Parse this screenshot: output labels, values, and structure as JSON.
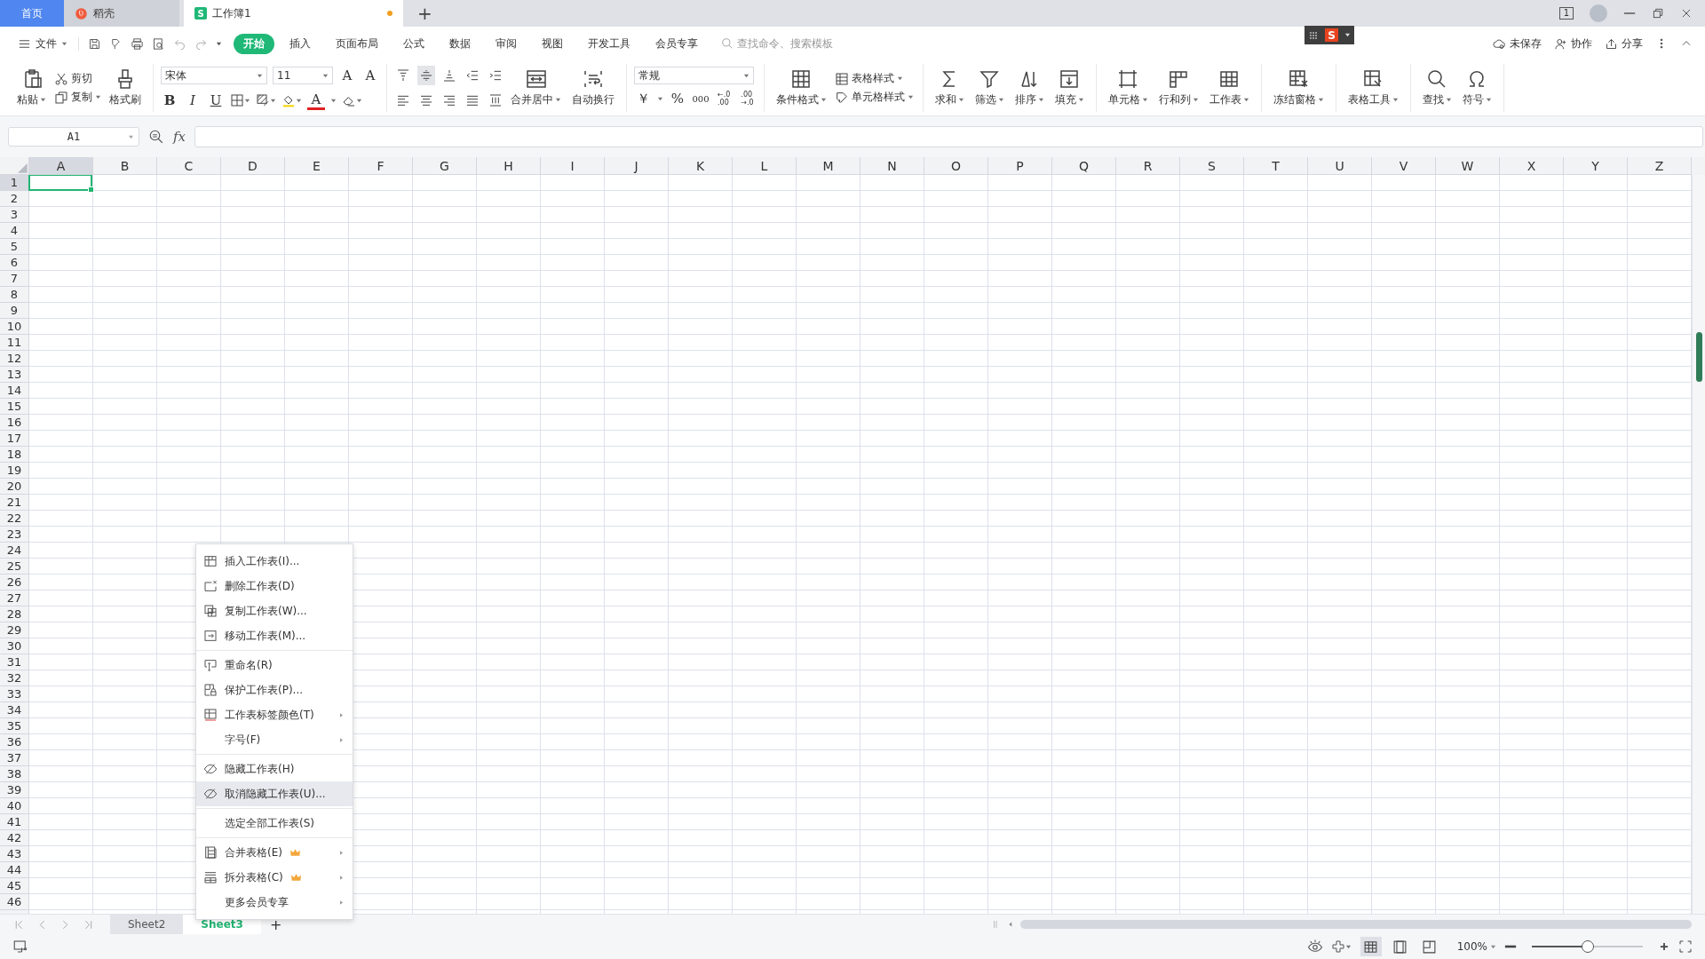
{
  "tabs": [
    {
      "kind": "home",
      "label": "首页",
      "selected": false
    },
    {
      "kind": "docer",
      "label": "稻壳",
      "selected": false
    },
    {
      "kind": "workbook",
      "label": "工作簿1",
      "icon_letter": "S",
      "modified": true,
      "selected": true
    }
  ],
  "new_tab": "+",
  "window_count": "1",
  "menu": {
    "file": "文件",
    "items": [
      {
        "label": "开始",
        "selected": true
      },
      {
        "label": "插入",
        "selected": false
      },
      {
        "label": "页面布局",
        "selected": false
      },
      {
        "label": "公式",
        "selected": false
      },
      {
        "label": "数据",
        "selected": false
      },
      {
        "label": "审阅",
        "selected": false
      },
      {
        "label": "视图",
        "selected": false
      },
      {
        "label": "开发工具",
        "selected": false
      },
      {
        "label": "会员专享",
        "selected": false
      }
    ],
    "search": {
      "placeholder": "查找命令、搜索模板"
    }
  },
  "ime": {
    "logo": "S"
  },
  "actions": [
    {
      "label": "未保存"
    },
    {
      "label": "协作"
    },
    {
      "label": "分享"
    }
  ],
  "ribbon": {
    "clipboard": {
      "paste": {
        "label": "粘贴",
        "dropdown": true
      },
      "cut": {
        "label": "剪切",
        "dropdown": false
      },
      "copy": {
        "label": "复制",
        "dropdown": true
      },
      "painter": {
        "label": "格式刷",
        "dropdown": false
      }
    },
    "font": {
      "name": "宋体",
      "size": "11",
      "grow": "A",
      "shrink": "A",
      "bold": "B",
      "italic": "I",
      "underline": "U",
      "tint": "A"
    },
    "alignment": {
      "merge": {
        "label": "合并居中",
        "dropdown": true
      },
      "wrap": {
        "label": "自动换行",
        "dropdown": false
      }
    },
    "number": {
      "format": "常规",
      "currency": "￥",
      "percent": "%",
      "thousands": "000",
      "decimals": [
        {
          "top": "←.0",
          "bottom": ".00"
        },
        {
          "top": ".00",
          "bottom": "→.0"
        }
      ]
    },
    "styles": {
      "conditional": {
        "label": "条件格式",
        "dropdown": true
      },
      "table_style": {
        "label": "表格样式",
        "dropdown": true
      },
      "cell_style": {
        "label": "单元格样式",
        "dropdown": true
      }
    },
    "tools": [
      [
        {
          "label": "求和",
          "dropdown": true
        },
        {
          "label": "筛选",
          "dropdown": true
        },
        {
          "label": "排序",
          "dropdown": true
        },
        {
          "label": "填充",
          "dropdown": true
        }
      ],
      [
        {
          "label": "单元格",
          "dropdown": true
        },
        {
          "label": "行和列",
          "dropdown": true
        },
        {
          "label": "工作表",
          "dropdown": true
        }
      ],
      [
        {
          "label": "冻结窗格",
          "dropdown": true
        }
      ],
      [
        {
          "label": "表格工具",
          "dropdown": true
        }
      ],
      [
        {
          "label": "查找",
          "dropdown": true
        },
        {
          "label": "符号",
          "dropdown": true
        }
      ]
    ]
  },
  "name_box": "A1",
  "fx": "fx",
  "columns": [
    {
      "label": "A",
      "selected": true
    },
    {
      "label": "B",
      "selected": false
    },
    {
      "label": "C",
      "selected": false
    },
    {
      "label": "D",
      "selected": false
    },
    {
      "label": "E",
      "selected": false
    },
    {
      "label": "F",
      "selected": false
    },
    {
      "label": "G",
      "selected": false
    },
    {
      "label": "H",
      "selected": false
    },
    {
      "label": "I",
      "selected": false
    },
    {
      "label": "J",
      "selected": false
    },
    {
      "label": "K",
      "selected": false
    },
    {
      "label": "L",
      "selected": false
    },
    {
      "label": "M",
      "selected": false
    },
    {
      "label": "N",
      "selected": false
    },
    {
      "label": "O",
      "selected": false
    },
    {
      "label": "P",
      "selected": false
    },
    {
      "label": "Q",
      "selected": false
    },
    {
      "label": "R",
      "selected": false
    },
    {
      "label": "S",
      "selected": false
    },
    {
      "label": "T",
      "selected": false
    },
    {
      "label": "U",
      "selected": false
    },
    {
      "label": "V",
      "selected": false
    },
    {
      "label": "W",
      "selected": false
    },
    {
      "label": "X",
      "selected": false
    },
    {
      "label": "Y",
      "selected": false
    },
    {
      "label": "Z",
      "selected": false
    }
  ],
  "rows": [
    {
      "label": "1",
      "selected": true
    },
    {
      "label": "2",
      "selected": false
    },
    {
      "label": "3",
      "selected": false
    },
    {
      "label": "4",
      "selected": false
    },
    {
      "label": "5",
      "selected": false
    },
    {
      "label": "6",
      "selected": false
    },
    {
      "label": "7",
      "selected": false
    },
    {
      "label": "8",
      "selected": false
    },
    {
      "label": "9",
      "selected": false
    },
    {
      "label": "10",
      "selected": false
    },
    {
      "label": "11",
      "selected": false
    },
    {
      "label": "12",
      "selected": false
    },
    {
      "label": "13",
      "selected": false
    },
    {
      "label": "14",
      "selected": false
    },
    {
      "label": "15",
      "selected": false
    },
    {
      "label": "16",
      "selected": false
    },
    {
      "label": "17",
      "selected": false
    },
    {
      "label": "18",
      "selected": false
    },
    {
      "label": "19",
      "selected": false
    },
    {
      "label": "20",
      "selected": false
    },
    {
      "label": "21",
      "selected": false
    },
    {
      "label": "22",
      "selected": false
    },
    {
      "label": "23",
      "selected": false
    },
    {
      "label": "24",
      "selected": false
    },
    {
      "label": "25",
      "selected": false
    },
    {
      "label": "26",
      "selected": false
    },
    {
      "label": "27",
      "selected": false
    },
    {
      "label": "28",
      "selected": false
    },
    {
      "label": "29",
      "selected": false
    },
    {
      "label": "30",
      "selected": false
    },
    {
      "label": "31",
      "selected": false
    },
    {
      "label": "32",
      "selected": false
    },
    {
      "label": "33",
      "selected": false
    },
    {
      "label": "34",
      "selected": false
    },
    {
      "label": "35",
      "selected": false
    },
    {
      "label": "36",
      "selected": false
    },
    {
      "label": "37",
      "selected": false
    },
    {
      "label": "38",
      "selected": false
    },
    {
      "label": "39",
      "selected": false
    },
    {
      "label": "40",
      "selected": false
    },
    {
      "label": "41",
      "selected": false
    },
    {
      "label": "42",
      "selected": false
    },
    {
      "label": "43",
      "selected": false
    },
    {
      "label": "44",
      "selected": false
    },
    {
      "label": "45",
      "selected": false
    },
    {
      "label": "46",
      "selected": false
    }
  ],
  "context_menu": {
    "groups": [
      [
        {
          "label": "插入工作表(I)...",
          "submenu": false,
          "premium": false,
          "hovered": false
        },
        {
          "label": "删除工作表(D)",
          "submenu": false,
          "premium": false,
          "hovered": false
        },
        {
          "label": "复制工作表(W)...",
          "submenu": false,
          "premium": false,
          "hovered": false
        },
        {
          "label": "移动工作表(M)...",
          "submenu": false,
          "premium": false,
          "hovered": false
        }
      ],
      [
        {
          "label": "重命名(R)",
          "submenu": false,
          "premium": false,
          "hovered": false
        },
        {
          "label": "保护工作表(P)...",
          "submenu": false,
          "premium": false,
          "hovered": false
        },
        {
          "label": "工作表标签颜色(T)",
          "submenu": true,
          "premium": false,
          "hovered": false
        },
        {
          "label": "字号(F)",
          "submenu": true,
          "premium": false,
          "hovered": false
        }
      ],
      [
        {
          "label": "隐藏工作表(H)",
          "submenu": false,
          "premium": false,
          "hovered": false
        },
        {
          "label": "取消隐藏工作表(U)...",
          "submenu": false,
          "premium": false,
          "hovered": true
        }
      ],
      [
        {
          "label": "选定全部工作表(S)",
          "submenu": false,
          "premium": false,
          "hovered": false
        }
      ],
      [
        {
          "label": "合并表格(E)",
          "submenu": true,
          "premium": true,
          "hovered": false
        },
        {
          "label": "拆分表格(C)",
          "submenu": true,
          "premium": true,
          "hovered": false
        },
        {
          "label": "更多会员专享",
          "submenu": true,
          "premium": false,
          "hovered": false
        }
      ]
    ]
  },
  "sheet_tabs": [
    {
      "label": "Sheet2",
      "selected": false
    },
    {
      "label": "Sheet3",
      "selected": true
    }
  ],
  "new_sheet": "+",
  "status_bar": {
    "zoom": "100%",
    "zoom_slider": {
      "level": 0.5
    },
    "views": [
      {
        "selected": true
      },
      {
        "selected": false
      },
      {
        "selected": false
      }
    ]
  }
}
